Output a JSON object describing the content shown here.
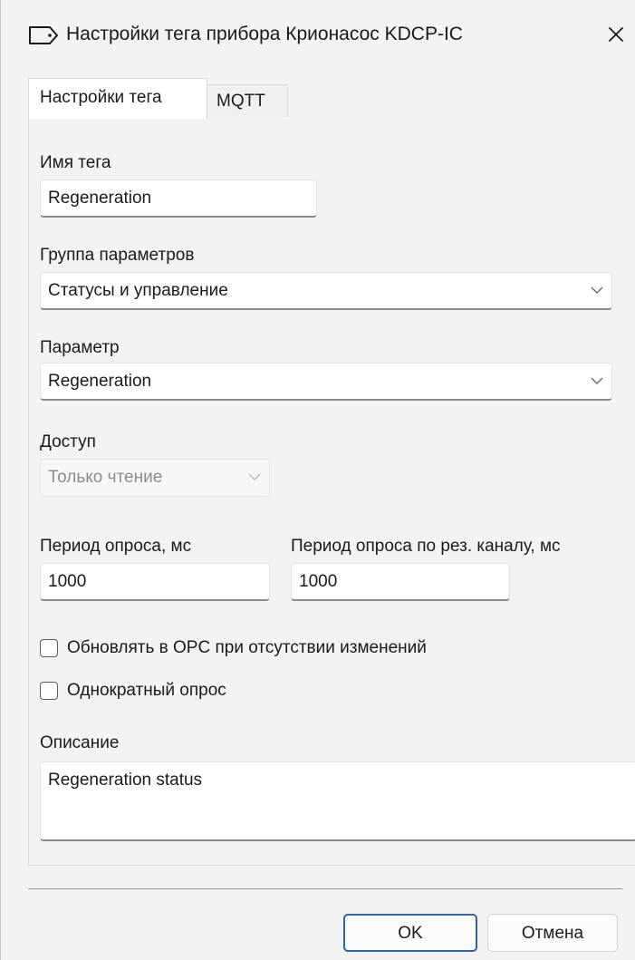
{
  "window": {
    "title": "Настройки тега прибора Крионасос KDCP-IC"
  },
  "tabs": [
    {
      "label": "Настройки тега",
      "active": true
    },
    {
      "label": "MQTT",
      "active": false
    }
  ],
  "form": {
    "tag_name": {
      "label": "Имя тега",
      "value": "Regeneration"
    },
    "param_group": {
      "label": "Группа параметров",
      "value": "Статусы и управление"
    },
    "parameter": {
      "label": "Параметр",
      "value": "Regeneration"
    },
    "access": {
      "label": "Доступ",
      "value": "Только чтение",
      "enabled": false
    },
    "poll_period": {
      "label": "Период опроса, мс",
      "value": "1000"
    },
    "poll_period_reserve": {
      "label": "Период опроса по рез. каналу, мс",
      "value": "1000"
    },
    "update_opc": {
      "label": "Обновлять в OPC при отсутствии изменений",
      "checked": false
    },
    "single_poll": {
      "label": "Однократный опрос",
      "checked": false
    },
    "description": {
      "label": "Описание",
      "value": "Regeneration status"
    }
  },
  "buttons": {
    "ok": "OK",
    "cancel": "Отмена"
  },
  "colors": {
    "window_bg": "#f3f3f3",
    "field_bg": "#ffffff",
    "ok_border": "#2d63a8",
    "disabled_text": "#8c8c8c"
  },
  "icons": {
    "title": "tag-icon",
    "close": "close-icon",
    "dropdown": "chevron-down-icon"
  }
}
